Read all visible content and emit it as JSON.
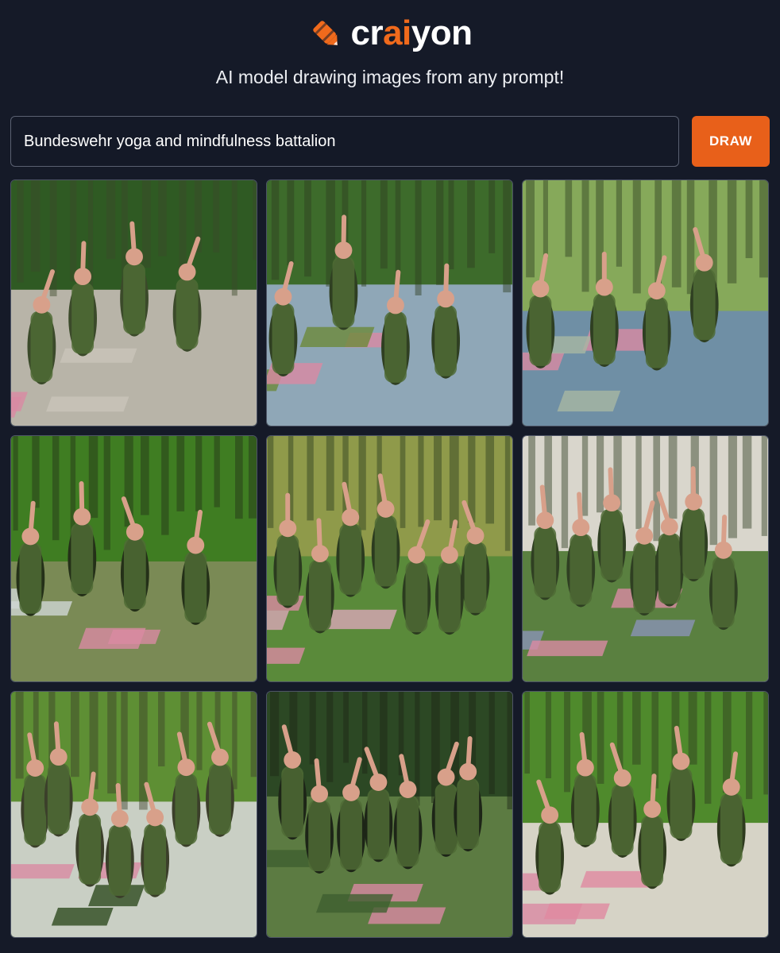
{
  "brand": {
    "name_prefix": "cr",
    "name_accent": "ai",
    "name_suffix": "yon",
    "logo_icon": "crayon-icon",
    "accent_color": "#f06a1c"
  },
  "tagline": "AI model drawing images from any prompt!",
  "search": {
    "value": "Bundeswehr yoga and mindfulness battalion",
    "placeholder": ""
  },
  "draw_button": {
    "label": "DRAW",
    "color": "#e8601a"
  },
  "results": [
    {
      "scene": "soldiers-row-paving",
      "palette": [
        "#2f5a23",
        "#b8b4a8",
        "#c9c4b9",
        "#3b4a2a"
      ]
    },
    {
      "scene": "yoga-mats-trees",
      "palette": [
        "#3d6b2b",
        "#8fa7b7",
        "#6c8a3a",
        "#2f3f22"
      ]
    },
    {
      "scene": "standing-poses-mats",
      "palette": [
        "#86a95a",
        "#6f8fa5",
        "#a7b7a2",
        "#2f3f22"
      ]
    },
    {
      "scene": "group-arms-up",
      "palette": [
        "#3f7d22",
        "#7a8a55",
        "#cfd6d5",
        "#243018"
      ]
    },
    {
      "scene": "lunge-poses-wall",
      "palette": [
        "#8f9a4a",
        "#5a8a3a",
        "#d9a6b8",
        "#2b3b1f"
      ]
    },
    {
      "scene": "mixed-poses-field",
      "palette": [
        "#d9d6cc",
        "#5a8040",
        "#8a92b5",
        "#2f3f22"
      ]
    },
    {
      "scene": "lying-poses-lawn",
      "palette": [
        "#5e8f34",
        "#c9cfc4",
        "#2e4a1f",
        "#3b3f2a"
      ]
    },
    {
      "scene": "soldiers-berets-closeup",
      "palette": [
        "#2c4824",
        "#5c7b42",
        "#3f5f2f",
        "#1d2517"
      ]
    },
    {
      "scene": "warrior-poses-park",
      "palette": [
        "#4f8a2c",
        "#d6d3c6",
        "#e08aa0",
        "#2e3a1e"
      ]
    }
  ]
}
